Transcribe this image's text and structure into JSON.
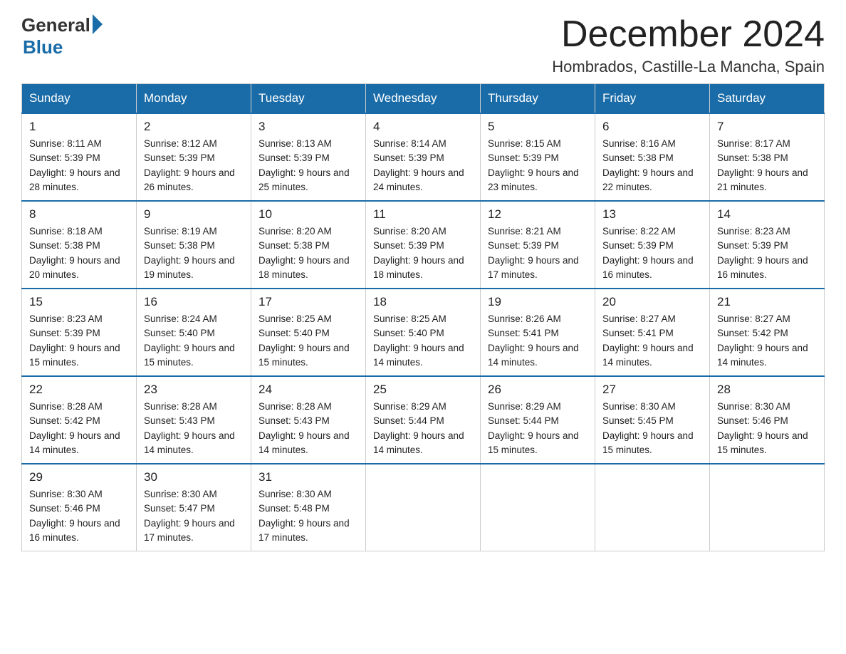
{
  "header": {
    "logo": {
      "text_general": "General",
      "text_blue": "Blue"
    },
    "month_year": "December 2024",
    "location": "Hombrados, Castille-La Mancha, Spain"
  },
  "weekdays": [
    "Sunday",
    "Monday",
    "Tuesday",
    "Wednesday",
    "Thursday",
    "Friday",
    "Saturday"
  ],
  "weeks": [
    [
      {
        "day": "1",
        "sunrise": "Sunrise: 8:11 AM",
        "sunset": "Sunset: 5:39 PM",
        "daylight": "Daylight: 9 hours and 28 minutes."
      },
      {
        "day": "2",
        "sunrise": "Sunrise: 8:12 AM",
        "sunset": "Sunset: 5:39 PM",
        "daylight": "Daylight: 9 hours and 26 minutes."
      },
      {
        "day": "3",
        "sunrise": "Sunrise: 8:13 AM",
        "sunset": "Sunset: 5:39 PM",
        "daylight": "Daylight: 9 hours and 25 minutes."
      },
      {
        "day": "4",
        "sunrise": "Sunrise: 8:14 AM",
        "sunset": "Sunset: 5:39 PM",
        "daylight": "Daylight: 9 hours and 24 minutes."
      },
      {
        "day": "5",
        "sunrise": "Sunrise: 8:15 AM",
        "sunset": "Sunset: 5:39 PM",
        "daylight": "Daylight: 9 hours and 23 minutes."
      },
      {
        "day": "6",
        "sunrise": "Sunrise: 8:16 AM",
        "sunset": "Sunset: 5:38 PM",
        "daylight": "Daylight: 9 hours and 22 minutes."
      },
      {
        "day": "7",
        "sunrise": "Sunrise: 8:17 AM",
        "sunset": "Sunset: 5:38 PM",
        "daylight": "Daylight: 9 hours and 21 minutes."
      }
    ],
    [
      {
        "day": "8",
        "sunrise": "Sunrise: 8:18 AM",
        "sunset": "Sunset: 5:38 PM",
        "daylight": "Daylight: 9 hours and 20 minutes."
      },
      {
        "day": "9",
        "sunrise": "Sunrise: 8:19 AM",
        "sunset": "Sunset: 5:38 PM",
        "daylight": "Daylight: 9 hours and 19 minutes."
      },
      {
        "day": "10",
        "sunrise": "Sunrise: 8:20 AM",
        "sunset": "Sunset: 5:38 PM",
        "daylight": "Daylight: 9 hours and 18 minutes."
      },
      {
        "day": "11",
        "sunrise": "Sunrise: 8:20 AM",
        "sunset": "Sunset: 5:39 PM",
        "daylight": "Daylight: 9 hours and 18 minutes."
      },
      {
        "day": "12",
        "sunrise": "Sunrise: 8:21 AM",
        "sunset": "Sunset: 5:39 PM",
        "daylight": "Daylight: 9 hours and 17 minutes."
      },
      {
        "day": "13",
        "sunrise": "Sunrise: 8:22 AM",
        "sunset": "Sunset: 5:39 PM",
        "daylight": "Daylight: 9 hours and 16 minutes."
      },
      {
        "day": "14",
        "sunrise": "Sunrise: 8:23 AM",
        "sunset": "Sunset: 5:39 PM",
        "daylight": "Daylight: 9 hours and 16 minutes."
      }
    ],
    [
      {
        "day": "15",
        "sunrise": "Sunrise: 8:23 AM",
        "sunset": "Sunset: 5:39 PM",
        "daylight": "Daylight: 9 hours and 15 minutes."
      },
      {
        "day": "16",
        "sunrise": "Sunrise: 8:24 AM",
        "sunset": "Sunset: 5:40 PM",
        "daylight": "Daylight: 9 hours and 15 minutes."
      },
      {
        "day": "17",
        "sunrise": "Sunrise: 8:25 AM",
        "sunset": "Sunset: 5:40 PM",
        "daylight": "Daylight: 9 hours and 15 minutes."
      },
      {
        "day": "18",
        "sunrise": "Sunrise: 8:25 AM",
        "sunset": "Sunset: 5:40 PM",
        "daylight": "Daylight: 9 hours and 14 minutes."
      },
      {
        "day": "19",
        "sunrise": "Sunrise: 8:26 AM",
        "sunset": "Sunset: 5:41 PM",
        "daylight": "Daylight: 9 hours and 14 minutes."
      },
      {
        "day": "20",
        "sunrise": "Sunrise: 8:27 AM",
        "sunset": "Sunset: 5:41 PM",
        "daylight": "Daylight: 9 hours and 14 minutes."
      },
      {
        "day": "21",
        "sunrise": "Sunrise: 8:27 AM",
        "sunset": "Sunset: 5:42 PM",
        "daylight": "Daylight: 9 hours and 14 minutes."
      }
    ],
    [
      {
        "day": "22",
        "sunrise": "Sunrise: 8:28 AM",
        "sunset": "Sunset: 5:42 PM",
        "daylight": "Daylight: 9 hours and 14 minutes."
      },
      {
        "day": "23",
        "sunrise": "Sunrise: 8:28 AM",
        "sunset": "Sunset: 5:43 PM",
        "daylight": "Daylight: 9 hours and 14 minutes."
      },
      {
        "day": "24",
        "sunrise": "Sunrise: 8:28 AM",
        "sunset": "Sunset: 5:43 PM",
        "daylight": "Daylight: 9 hours and 14 minutes."
      },
      {
        "day": "25",
        "sunrise": "Sunrise: 8:29 AM",
        "sunset": "Sunset: 5:44 PM",
        "daylight": "Daylight: 9 hours and 14 minutes."
      },
      {
        "day": "26",
        "sunrise": "Sunrise: 8:29 AM",
        "sunset": "Sunset: 5:44 PM",
        "daylight": "Daylight: 9 hours and 15 minutes."
      },
      {
        "day": "27",
        "sunrise": "Sunrise: 8:30 AM",
        "sunset": "Sunset: 5:45 PM",
        "daylight": "Daylight: 9 hours and 15 minutes."
      },
      {
        "day": "28",
        "sunrise": "Sunrise: 8:30 AM",
        "sunset": "Sunset: 5:46 PM",
        "daylight": "Daylight: 9 hours and 15 minutes."
      }
    ],
    [
      {
        "day": "29",
        "sunrise": "Sunrise: 8:30 AM",
        "sunset": "Sunset: 5:46 PM",
        "daylight": "Daylight: 9 hours and 16 minutes."
      },
      {
        "day": "30",
        "sunrise": "Sunrise: 8:30 AM",
        "sunset": "Sunset: 5:47 PM",
        "daylight": "Daylight: 9 hours and 17 minutes."
      },
      {
        "day": "31",
        "sunrise": "Sunrise: 8:30 AM",
        "sunset": "Sunset: 5:48 PM",
        "daylight": "Daylight: 9 hours and 17 minutes."
      },
      null,
      null,
      null,
      null
    ]
  ]
}
